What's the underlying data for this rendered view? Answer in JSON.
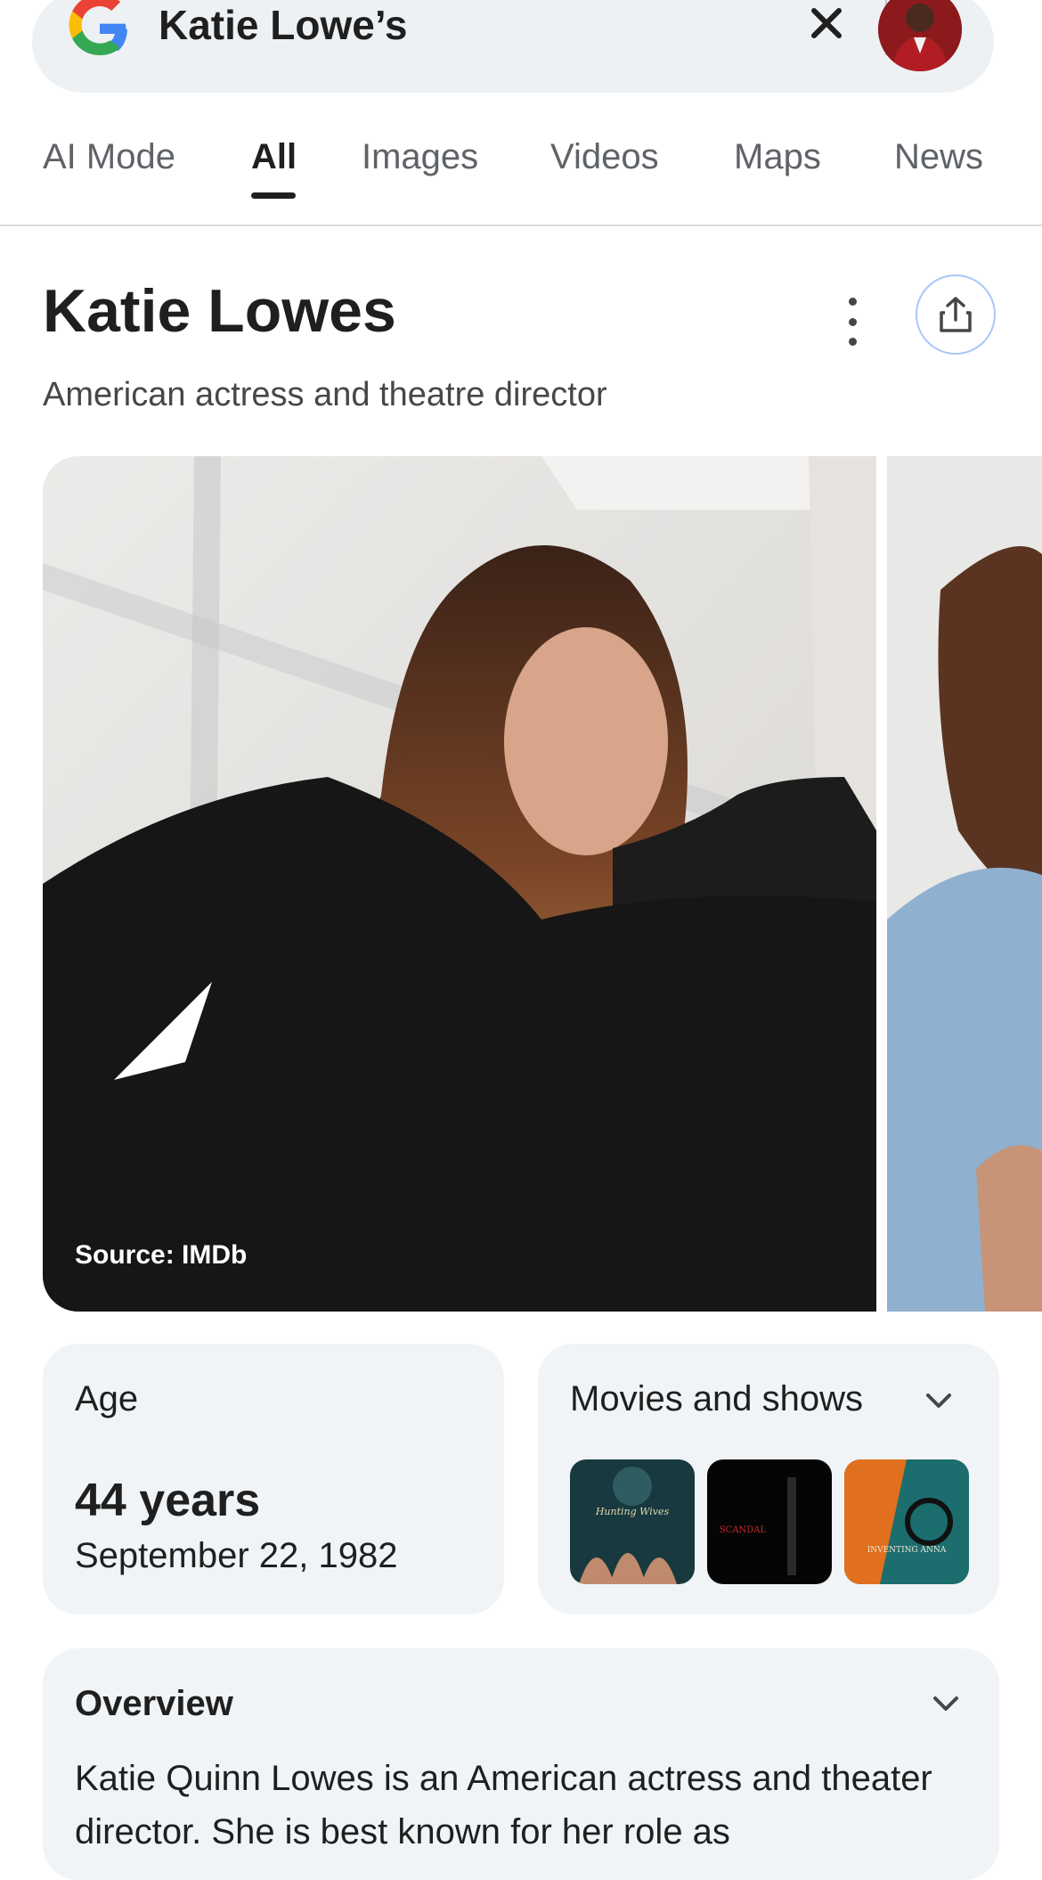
{
  "search": {
    "query": "Katie Lowe’s"
  },
  "tabs": [
    {
      "label": "AI Mode"
    },
    {
      "label": "All"
    },
    {
      "label": "Images"
    },
    {
      "label": "Videos"
    },
    {
      "label": "Maps"
    },
    {
      "label": "News"
    }
  ],
  "active_tab": "All",
  "entity": {
    "name": "Katie Lowes",
    "description": "American actress and theatre director",
    "photo_source": "Source: IMDb"
  },
  "age_card": {
    "label": "Age",
    "value": "44 years",
    "birth_date": "September 22, 1982"
  },
  "movies_card": {
    "label": "Movies and shows",
    "thumbnails": [
      {
        "caption": "Hunting Wives"
      },
      {
        "caption": "SCANDAL"
      },
      {
        "caption": "INVENTING ANNA"
      }
    ]
  },
  "overview": {
    "title": "Overview",
    "text": "Katie Quinn Lowes is an American actress and theater director. She is best known for her role as"
  },
  "colors": {
    "accent_blue": "#a8c7fa",
    "card_bg": "#f0f4f7",
    "search_bg": "#eef1f4"
  }
}
